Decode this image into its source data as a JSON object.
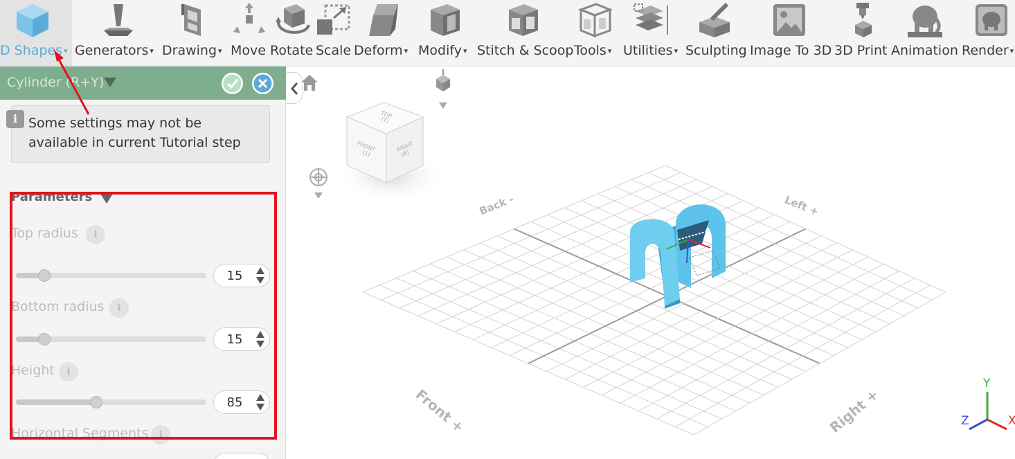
{
  "toolbar": {
    "items": [
      {
        "label": "D Shapes",
        "has_menu": true
      },
      {
        "label": "Generators",
        "has_menu": true
      },
      {
        "label": "Drawing",
        "has_menu": true
      },
      {
        "label": "Move",
        "has_menu": false
      },
      {
        "label": "Rotate",
        "has_menu": false
      },
      {
        "label": "Scale",
        "has_menu": false
      },
      {
        "label": "Deform",
        "has_menu": true
      },
      {
        "label": "Modify",
        "has_menu": true
      },
      {
        "label": "Stitch & Scoop",
        "has_menu": false
      },
      {
        "label": "Tools",
        "has_menu": true
      },
      {
        "label": "Utilities",
        "has_menu": true
      },
      {
        "label": "Sculpting",
        "has_menu": false
      },
      {
        "label": "Image To 3D",
        "has_menu": false
      },
      {
        "label": "3D Print",
        "has_menu": false
      },
      {
        "label": "Animation",
        "has_menu": false
      },
      {
        "label": "Render",
        "has_menu": true
      }
    ],
    "caret": "▾"
  },
  "panel": {
    "title": "Cylinder (R+Y)",
    "info_icon": "i",
    "info_line1": "Some settings may not be",
    "info_line2": "available in current Tutorial step",
    "parameters_heading": "Parameters",
    "params": [
      {
        "label": "Top radius",
        "value": "15",
        "fraction": 0.15
      },
      {
        "label": "Bottom radius",
        "value": "15",
        "fraction": 0.15
      },
      {
        "label": "Height",
        "value": "85",
        "fraction": 0.42
      }
    ],
    "partial_param_label": "Horizontal Segments",
    "info_glyph": "i"
  },
  "viewport": {
    "cube_labels": {
      "top": "TOP",
      "top_key": "(T)",
      "front": "FRONT",
      "front_key": "(1)",
      "right": "RIGHT",
      "right_key": "(6)"
    },
    "grid_labels": {
      "back": "Back -",
      "left": "Left +",
      "front": "Front +",
      "right": "Right +"
    },
    "axes": {
      "y": "Y",
      "x": "X",
      "z": "Z"
    },
    "colors": {
      "x": "#e8262b",
      "y": "#3eae3e",
      "z": "#3f4fd8",
      "shape": "#5ec3ea"
    }
  },
  "colors": {
    "accent": "#5aabd9",
    "header": "#7fae8e",
    "annotation": "#e0141e"
  }
}
